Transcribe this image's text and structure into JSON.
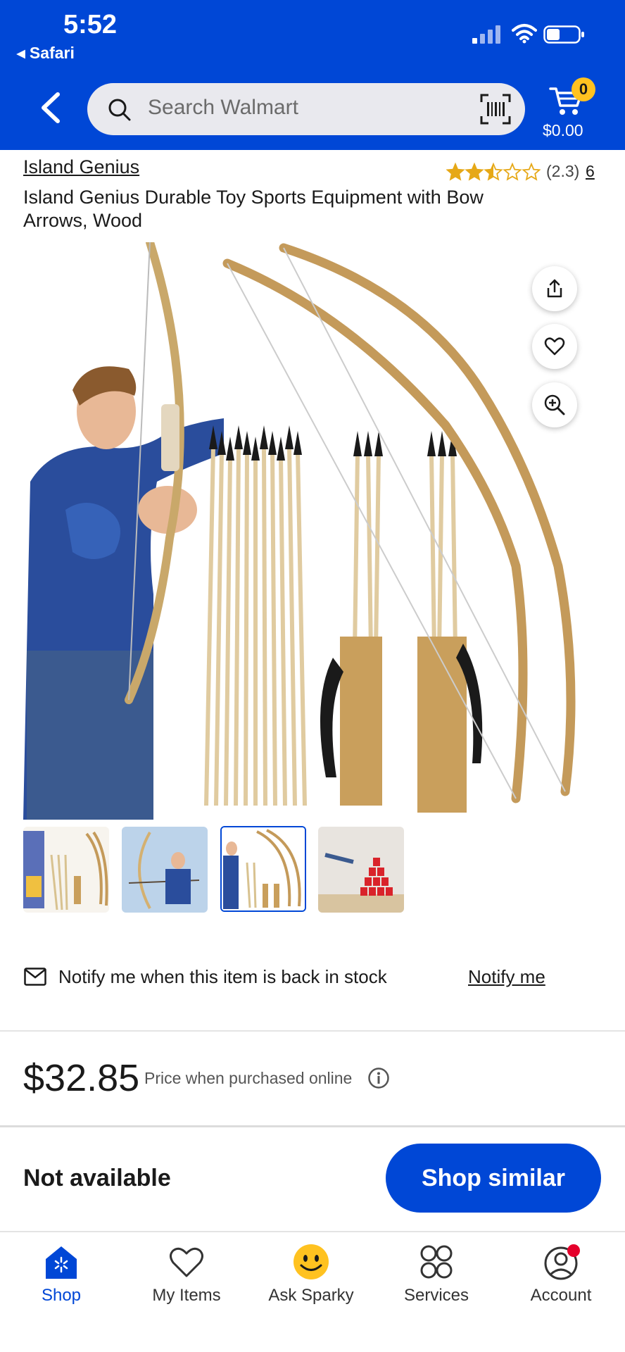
{
  "status_bar": {
    "time": "5:52",
    "back_app": "◂ Safari"
  },
  "header": {
    "search_placeholder": "Search Walmart",
    "cart_count": "0",
    "cart_total": "$0.00",
    "brand_color": "#0047d6",
    "badge_color": "#ffc220"
  },
  "product": {
    "brand": "Island Genius",
    "title": "Island Genius Durable Toy Sports Equipment with Bow Arrows, Wood",
    "rating_text": "(2.3)",
    "rating_value": 2.3,
    "review_count": "6",
    "thumbnails_count": 4,
    "selected_thumbnail": 3
  },
  "icons": [
    "share-icon",
    "heart-icon",
    "zoom-in-icon",
    "mail-icon",
    "info-icon",
    "cart-icon",
    "barcode-scan-icon",
    "search-icon",
    "back-chevron-icon"
  ],
  "notify": {
    "text": "Notify me when this item is back in stock",
    "link": "Notify me"
  },
  "price": {
    "amount": "$32.85",
    "note": "Price when purchased online"
  },
  "availability": {
    "status": "Not available",
    "button": "Shop similar"
  },
  "bottom_nav": {
    "shop": "Shop",
    "my_items": "My Items",
    "ask_sparky": "Ask Sparky",
    "services": "Services",
    "account": "Account"
  }
}
